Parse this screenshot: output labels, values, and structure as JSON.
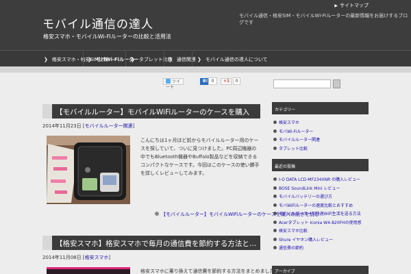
{
  "header": {
    "site_title": "モバイル通信の達人",
    "tagline": "格安スマホ・モバイルWi-Fiルーターの比較と活用法",
    "description": "モバイル通信・格安SIM・モバイルWi-Fiルーターの最新情報をお届けするブログです",
    "top_link": "サイトマップ"
  },
  "nav": {
    "items": [
      {
        "label": "格安スマホ・格安SIM比較"
      },
      {
        "label": "モバWi-Fiルーター"
      },
      {
        "label": "タブレット比較"
      },
      {
        "label": "通信関連"
      },
      {
        "label": "モバイル通信の達人について"
      }
    ]
  },
  "share": {
    "tweet_label": "ツイート",
    "hatena_count": "0",
    "gplus_label": "+1",
    "gplus_count": "0"
  },
  "posts": [
    {
      "title": "【モバイルルーター】モバイルWiFiルーターのケースを購入",
      "date": "2014年11月23日",
      "category": "モバイルルーター関連",
      "body": "こんにちは1ヶ月ほど前からモバイルルーター用のケースを探していて、ついに見つけました。PC周辺機器の中でもBluetooth機器やBuffalo製品などを収納できるコンパクトなケースです。今回はこのケースの使い勝手を詳しくレビューしてみます。",
      "read_more": "【モバイルルーター】モバイルWiFiルーターのケースを購入の続きを読む"
    },
    {
      "title": "【格安スマホ】格安スマホで毎月の通信費を節約する方法と…",
      "date": "2014年11月08日",
      "category": "格安スマホ",
      "body": "格安スマホに乗り換えて通信費を節約する方法をまとめました。"
    }
  ],
  "sidebar": {
    "search_placeholder": "",
    "widgets": [
      {
        "title": "カテゴリー",
        "items": [
          "格安スマホ",
          "モバWi-Fiルーター",
          "モバイルルーター関連",
          "タブレット比較"
        ]
      },
      {
        "title": "最近の投稿",
        "items": [
          "I-O DATA LCD-MF234XNR の購入レビュー",
          "BOSE SoundLink Mini レビュー",
          "モバイルバッテリーの選び方",
          "モバWiFiルーターの速度比較とおすすめ",
          "モバイルルーターで快適WiFi生活を送る方法",
          "Acerタブレット Iconia W4-820FHの使用感",
          "格安スマホ比較",
          "Shure イヤホン購入レビュー",
          "通信費の節約"
        ]
      },
      {
        "title": "アーカイブ",
        "items": []
      }
    ]
  },
  "colors": {
    "header_bg": "#3d3d3d",
    "nav_bg": "#393939",
    "bar_bg": "#3b3b3b",
    "link": "#1a0dab",
    "page_bg": "#ededed"
  }
}
